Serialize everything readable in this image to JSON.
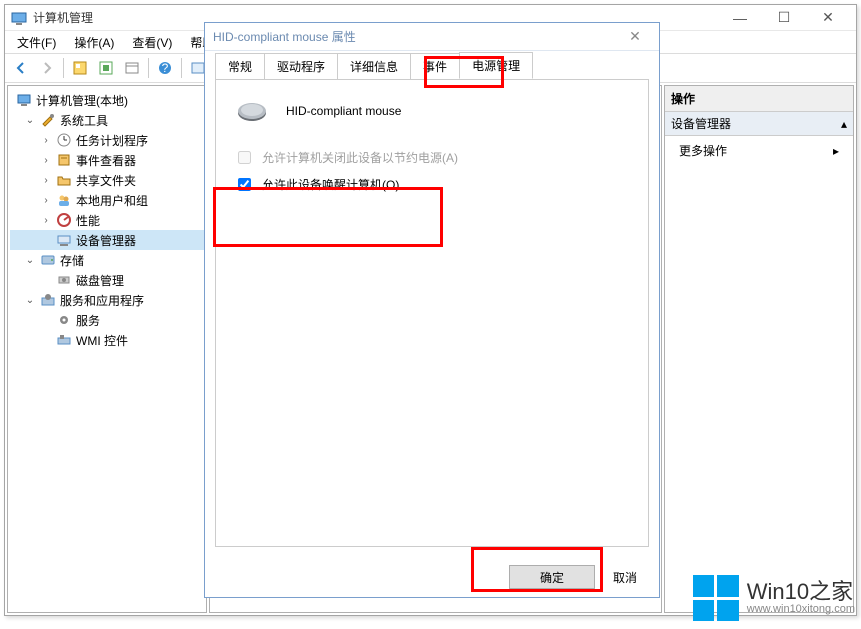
{
  "window": {
    "title": "计算机管理",
    "menu": {
      "file": "文件(F)",
      "action": "操作(A)",
      "view": "查看(V)",
      "help": "帮助"
    }
  },
  "tree": {
    "root": "计算机管理(本地)",
    "systools": "系统工具",
    "task": "任务计划程序",
    "event": "事件查看器",
    "share": "共享文件夹",
    "users": "本地用户和组",
    "perf": "性能",
    "devmgr": "设备管理器",
    "storage": "存储",
    "disk": "磁盘管理",
    "svcapp": "服务和应用程序",
    "services": "服务",
    "wmi": "WMI 控件"
  },
  "right": {
    "header": "操作",
    "sub": "设备管理器",
    "more": "更多操作"
  },
  "dialog": {
    "title": "HID-compliant mouse 属性",
    "tabs": {
      "general": "常规",
      "driver": "驱动程序",
      "details": "详细信息",
      "events": "事件",
      "power": "电源管理"
    },
    "device": "HID-compliant mouse",
    "chk1": "允许计算机关闭此设备以节约电源(A)",
    "chk2": "允许此设备唤醒计算机(O)",
    "ok": "确定",
    "cancel": "取消"
  },
  "watermark": {
    "big": "Win10之家",
    "small": "www.win10xitong.com"
  }
}
